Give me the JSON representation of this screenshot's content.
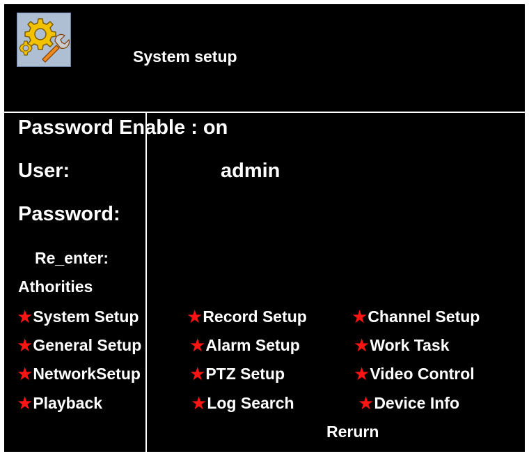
{
  "header": {
    "title": "System setup",
    "icon": "settings-gear-wrench-icon"
  },
  "form": {
    "password_enable_label": "Password Enable : on",
    "user_label": "User:",
    "user_value": "admin",
    "password_label": "Password:",
    "reenter_label": "Re_enter:"
  },
  "authorities": {
    "heading": "Athorities",
    "items": [
      {
        "label": "System Setup"
      },
      {
        "label": "Record Setup"
      },
      {
        "label": "Channel Setup"
      },
      {
        "label": "General Setup"
      },
      {
        "label": "Alarm Setup"
      },
      {
        "label": "Work Task"
      },
      {
        "label": "NetworkSetup"
      },
      {
        "label": "PTZ Setup"
      },
      {
        "label": "Video Control"
      },
      {
        "label": "Playback"
      },
      {
        "label": "Log Search"
      },
      {
        "label": "Device Info"
      }
    ],
    "marker_color": "#ff1414"
  },
  "footer": {
    "return_label": "Rerurn"
  },
  "colors": {
    "background": "#000000",
    "text": "#ffffff",
    "icon_bg": "#aebfd4"
  }
}
